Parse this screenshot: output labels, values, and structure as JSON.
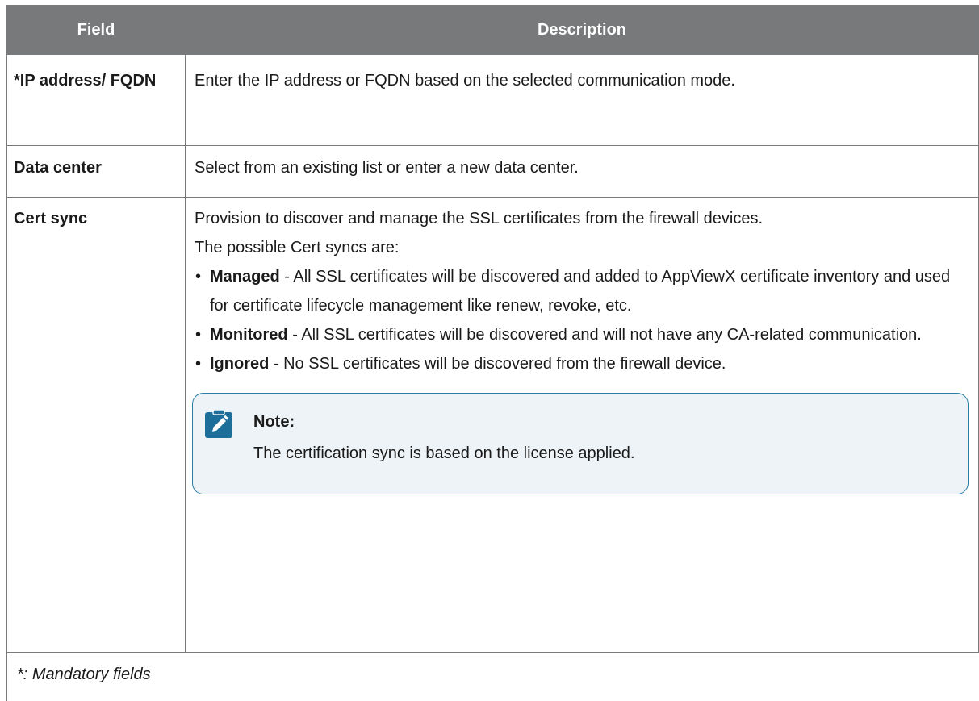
{
  "table": {
    "headers": {
      "field": "Field",
      "description": "Description"
    },
    "rows": {
      "ip": {
        "field": "*IP address/ FQDN",
        "description": "Enter the IP address or FQDN based on the selected communication mode."
      },
      "dc": {
        "field": "Data center",
        "description": "Select from an existing list or enter a new data center."
      },
      "cert": {
        "field": "Cert sync",
        "intro_1": "Provision to discover and manage the SSL certificates from the firewall devices.",
        "intro_2": "The possible Cert syncs are:",
        "bullets": [
          {
            "bullet": "•",
            "term": "Managed",
            "text": " - All SSL certificates will be discovered and added to AppViewX certificate inventory and used for certificate lifecycle management like renew, revoke, etc."
          },
          {
            "bullet": "•",
            "term": "Monitored",
            "text": " - All SSL certificates will be discovered and will not have any CA-related communication."
          },
          {
            "bullet": "•",
            "term": "Ignored",
            "text": " - No SSL certificates will be discovered from the firewall device."
          }
        ],
        "note": {
          "icon": "pencil-note-icon",
          "title": "Note:",
          "body": "The certification sync is based on the license applied."
        }
      }
    },
    "footnote": "*: Mandatory fields"
  },
  "colors": {
    "header_bg": "#78797b",
    "border": "#7a7a7a",
    "note_border": "#2a7ea6",
    "note_bg": "#eef3f7",
    "note_icon_bg": "#1d6f9a"
  }
}
